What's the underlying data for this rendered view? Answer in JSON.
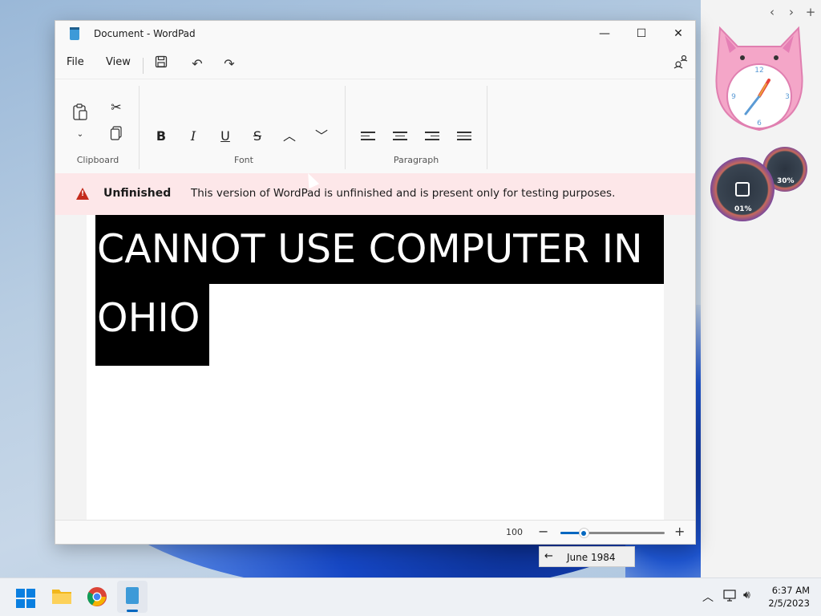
{
  "window": {
    "title": "Document - WordPad",
    "minimize_glyph": "—",
    "maximize_glyph": "☐",
    "close_glyph": "✕"
  },
  "menu": {
    "file": "File",
    "view": "View"
  },
  "ribbon": {
    "groups": {
      "clipboard": "Clipboard",
      "font": "Font",
      "paragraph": "Paragraph"
    },
    "font_buttons": {
      "bold": "B",
      "italic": "I",
      "underline": "U",
      "strike": "S"
    }
  },
  "infobar": {
    "title": "Unfinished",
    "message": "This version of WordPad is unfinished and is present only for testing purposes."
  },
  "document": {
    "lines": [
      "CANNOT USE COMPUTER IN",
      "OHIO"
    ]
  },
  "statusbar": {
    "zoom_value": "100",
    "zoom_fraction": 0.22
  },
  "tooltip": {
    "text": "June 1984"
  },
  "widgets": {
    "gauge_big_label": "01%",
    "gauge_small_label": "30%",
    "clock_numbers": [
      "12",
      "3",
      "6",
      "9"
    ]
  },
  "taskbar": {
    "time": "6:37 AM",
    "date": "2/5/2023"
  },
  "colors": {
    "accent": "#0067c0",
    "infobar_bg": "#fde7e9",
    "warning": "#c42b1c"
  }
}
